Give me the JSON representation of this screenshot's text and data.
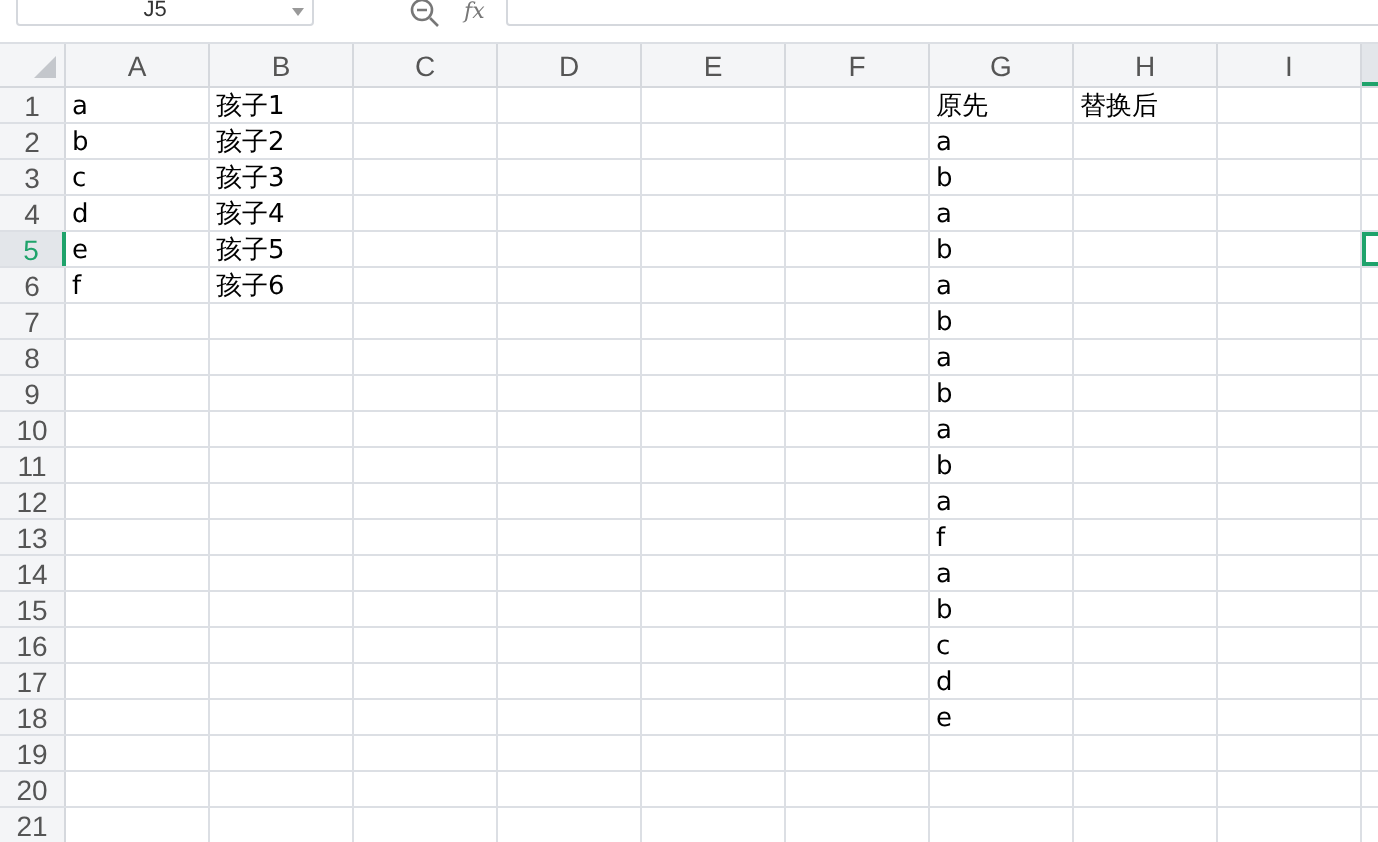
{
  "name_box": {
    "value": "J5"
  },
  "formula_bar": {
    "fx_label": "fx"
  },
  "columns": [
    {
      "label": "A",
      "selected": false
    },
    {
      "label": "B",
      "selected": false
    },
    {
      "label": "C",
      "selected": false
    },
    {
      "label": "D",
      "selected": false
    },
    {
      "label": "E",
      "selected": false
    },
    {
      "label": "F",
      "selected": false
    },
    {
      "label": "G",
      "selected": false
    },
    {
      "label": "H",
      "selected": false
    },
    {
      "label": "I",
      "selected": false
    }
  ],
  "partial_column": {
    "selected": true
  },
  "rows": [
    {
      "number": "1",
      "selected": false,
      "cells": {
        "A": "a",
        "B": "孩子1",
        "G": "原先",
        "H": "替换后"
      }
    },
    {
      "number": "2",
      "selected": false,
      "cells": {
        "A": "b",
        "B": "孩子2",
        "G": "a"
      }
    },
    {
      "number": "3",
      "selected": false,
      "cells": {
        "A": "c",
        "B": "孩子3",
        "G": "b"
      }
    },
    {
      "number": "4",
      "selected": false,
      "cells": {
        "A": "d",
        "B": "孩子4",
        "G": "a"
      }
    },
    {
      "number": "5",
      "selected": true,
      "cells": {
        "A": "e",
        "B": "孩子5",
        "G": "b"
      }
    },
    {
      "number": "6",
      "selected": false,
      "cells": {
        "A": "f",
        "B": "孩子6",
        "G": "a"
      }
    },
    {
      "number": "7",
      "selected": false,
      "cells": {
        "G": "b"
      }
    },
    {
      "number": "8",
      "selected": false,
      "cells": {
        "G": "a"
      }
    },
    {
      "number": "9",
      "selected": false,
      "cells": {
        "G": "b"
      }
    },
    {
      "number": "10",
      "selected": false,
      "cells": {
        "G": "a"
      }
    },
    {
      "number": "11",
      "selected": false,
      "cells": {
        "G": "b"
      }
    },
    {
      "number": "12",
      "selected": false,
      "cells": {
        "G": "a"
      }
    },
    {
      "number": "13",
      "selected": false,
      "cells": {
        "G": "f"
      }
    },
    {
      "number": "14",
      "selected": false,
      "cells": {
        "G": "a"
      }
    },
    {
      "number": "15",
      "selected": false,
      "cells": {
        "G": "b"
      }
    },
    {
      "number": "16",
      "selected": false,
      "cells": {
        "G": "c"
      }
    },
    {
      "number": "17",
      "selected": false,
      "cells": {
        "G": "d"
      }
    },
    {
      "number": "18",
      "selected": false,
      "cells": {
        "G": "e"
      }
    },
    {
      "number": "19",
      "selected": false,
      "cells": {}
    },
    {
      "number": "20",
      "selected": false,
      "cells": {}
    },
    {
      "number": "21",
      "selected": false,
      "cells": {}
    }
  ]
}
